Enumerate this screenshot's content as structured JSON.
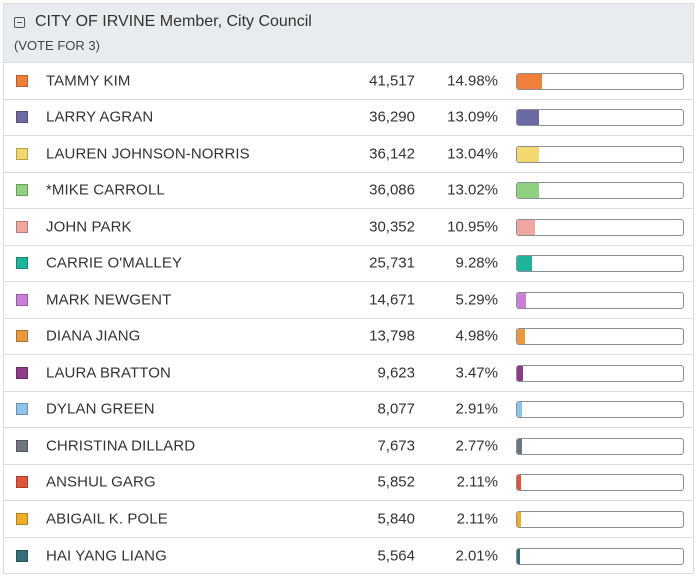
{
  "race": {
    "title": "CITY OF IRVINE Member, City Council",
    "subtitle": "(VOTE FOR 3)"
  },
  "candidates": [
    {
      "name": "TAMMY KIM",
      "votes": "41,517",
      "percent": "14.98%",
      "share": 14.98,
      "color": "#f07f3c"
    },
    {
      "name": "LARRY AGRAN",
      "votes": "36,290",
      "percent": "13.09%",
      "share": 13.09,
      "color": "#6b6ba3"
    },
    {
      "name": "LAUREN JOHNSON-NORRIS",
      "votes": "36,142",
      "percent": "13.04%",
      "share": 13.04,
      "color": "#f2d86e"
    },
    {
      "name": "*MIKE CARROLL",
      "votes": "36,086",
      "percent": "13.02%",
      "share": 13.02,
      "color": "#8fd17e"
    },
    {
      "name": "JOHN PARK",
      "votes": "30,352",
      "percent": "10.95%",
      "share": 10.95,
      "color": "#f0a6a0"
    },
    {
      "name": "CARRIE O'MALLEY",
      "votes": "25,731",
      "percent": "9.28%",
      "share": 9.28,
      "color": "#1fb39a"
    },
    {
      "name": "MARK NEWGENT",
      "votes": "14,671",
      "percent": "5.29%",
      "share": 5.29,
      "color": "#c97fd8"
    },
    {
      "name": "DIANA JIANG",
      "votes": "13,798",
      "percent": "4.98%",
      "share": 4.98,
      "color": "#e99a3e"
    },
    {
      "name": "LAURA BRATTON",
      "votes": "9,623",
      "percent": "3.47%",
      "share": 3.47,
      "color": "#8e3b8a"
    },
    {
      "name": "DYLAN GREEN",
      "votes": "8,077",
      "percent": "2.91%",
      "share": 2.91,
      "color": "#8ec2ea"
    },
    {
      "name": "CHRISTINA DILLARD",
      "votes": "7,673",
      "percent": "2.77%",
      "share": 2.77,
      "color": "#6e7680"
    },
    {
      "name": "ANSHUL GARG",
      "votes": "5,852",
      "percent": "2.11%",
      "share": 2.11,
      "color": "#e2533b"
    },
    {
      "name": "ABIGAIL K. POLE",
      "votes": "5,840",
      "percent": "2.11%",
      "share": 2.11,
      "color": "#efae2a"
    },
    {
      "name": "HAI YANG LIANG",
      "votes": "5,564",
      "percent": "2.01%",
      "share": 2.01,
      "color": "#356e78"
    }
  ]
}
